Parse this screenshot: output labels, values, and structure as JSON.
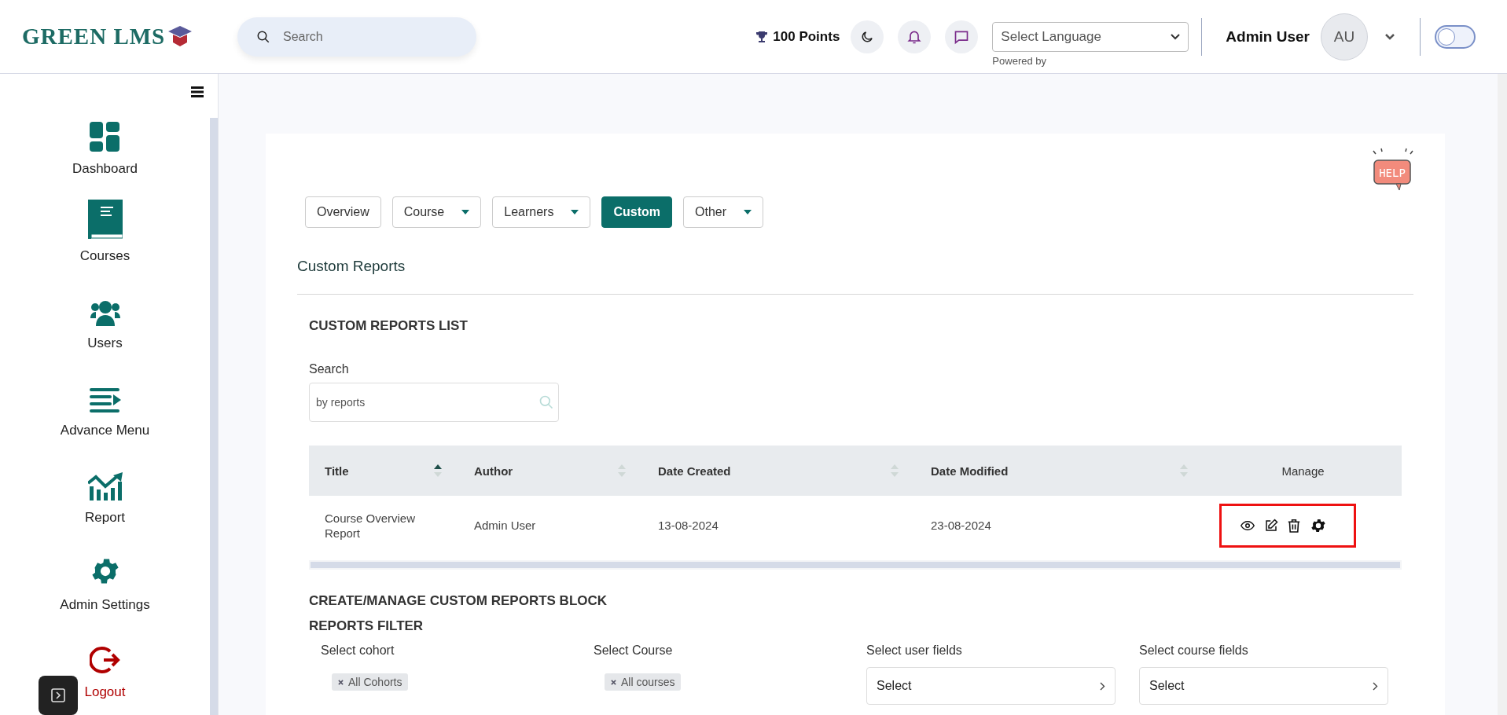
{
  "header": {
    "logo": "GREEN LMS",
    "search": {
      "placeholder": "Search"
    },
    "points": "100 Points",
    "language": {
      "placeholder": "Select Language",
      "note": "Powered by"
    },
    "user": {
      "name": "Admin User",
      "initials": "AU"
    },
    "theme_toggle": {
      "on": false
    }
  },
  "sidebar": {
    "items": [
      {
        "label": "Dashboard",
        "kind": "nav"
      },
      {
        "label": "Courses",
        "kind": "nav"
      },
      {
        "label": "Users",
        "kind": "nav"
      },
      {
        "label": "Advance Menu",
        "kind": "nav"
      },
      {
        "label": "Report",
        "kind": "nav"
      },
      {
        "label": "Admin Settings",
        "kind": "nav"
      },
      {
        "label": "Logout",
        "kind": "logout"
      }
    ]
  },
  "help": {
    "label": "HELP"
  },
  "tabs": [
    {
      "label": "Overview",
      "selected": false,
      "dropdown": false
    },
    {
      "label": "Course",
      "selected": false,
      "dropdown": true
    },
    {
      "label": "Learners",
      "selected": false,
      "dropdown": true
    },
    {
      "label": "Custom",
      "selected": true,
      "dropdown": false
    },
    {
      "label": "Other",
      "selected": false,
      "dropdown": true
    }
  ],
  "page_title": "Custom Reports",
  "list": {
    "heading": "CUSTOM REPORTS LIST",
    "search_label": "Search",
    "search_placeholder": "by reports",
    "table": {
      "columns": [
        {
          "label": "Title",
          "sortable": true,
          "sorted": true
        },
        {
          "label": "Author",
          "sortable": true,
          "sorted": false
        },
        {
          "label": "Date Created",
          "sortable": true,
          "sorted": false
        },
        {
          "label": "Date Modified",
          "sortable": true,
          "sorted": false
        },
        {
          "label": "Manage"
        }
      ],
      "rows": [
        {
          "title": "Course Overview Report",
          "author": "Admin User",
          "created": "13-08-2024",
          "modified": "23-08-2024",
          "highlighted": true
        }
      ]
    }
  },
  "create": {
    "heading": "CREATE/MANAGE CUSTOM REPORTS BLOCK",
    "filter_heading": "REPORTS FILTER",
    "filters": [
      {
        "label": "Select cohort",
        "kind": "chip",
        "value": "All Cohorts"
      },
      {
        "label": "Select Course",
        "kind": "chip",
        "value": "All courses"
      },
      {
        "label": "Select user fields",
        "kind": "select",
        "value": "Select"
      },
      {
        "label": "Select course fields",
        "kind": "select",
        "value": "Select"
      }
    ]
  }
}
